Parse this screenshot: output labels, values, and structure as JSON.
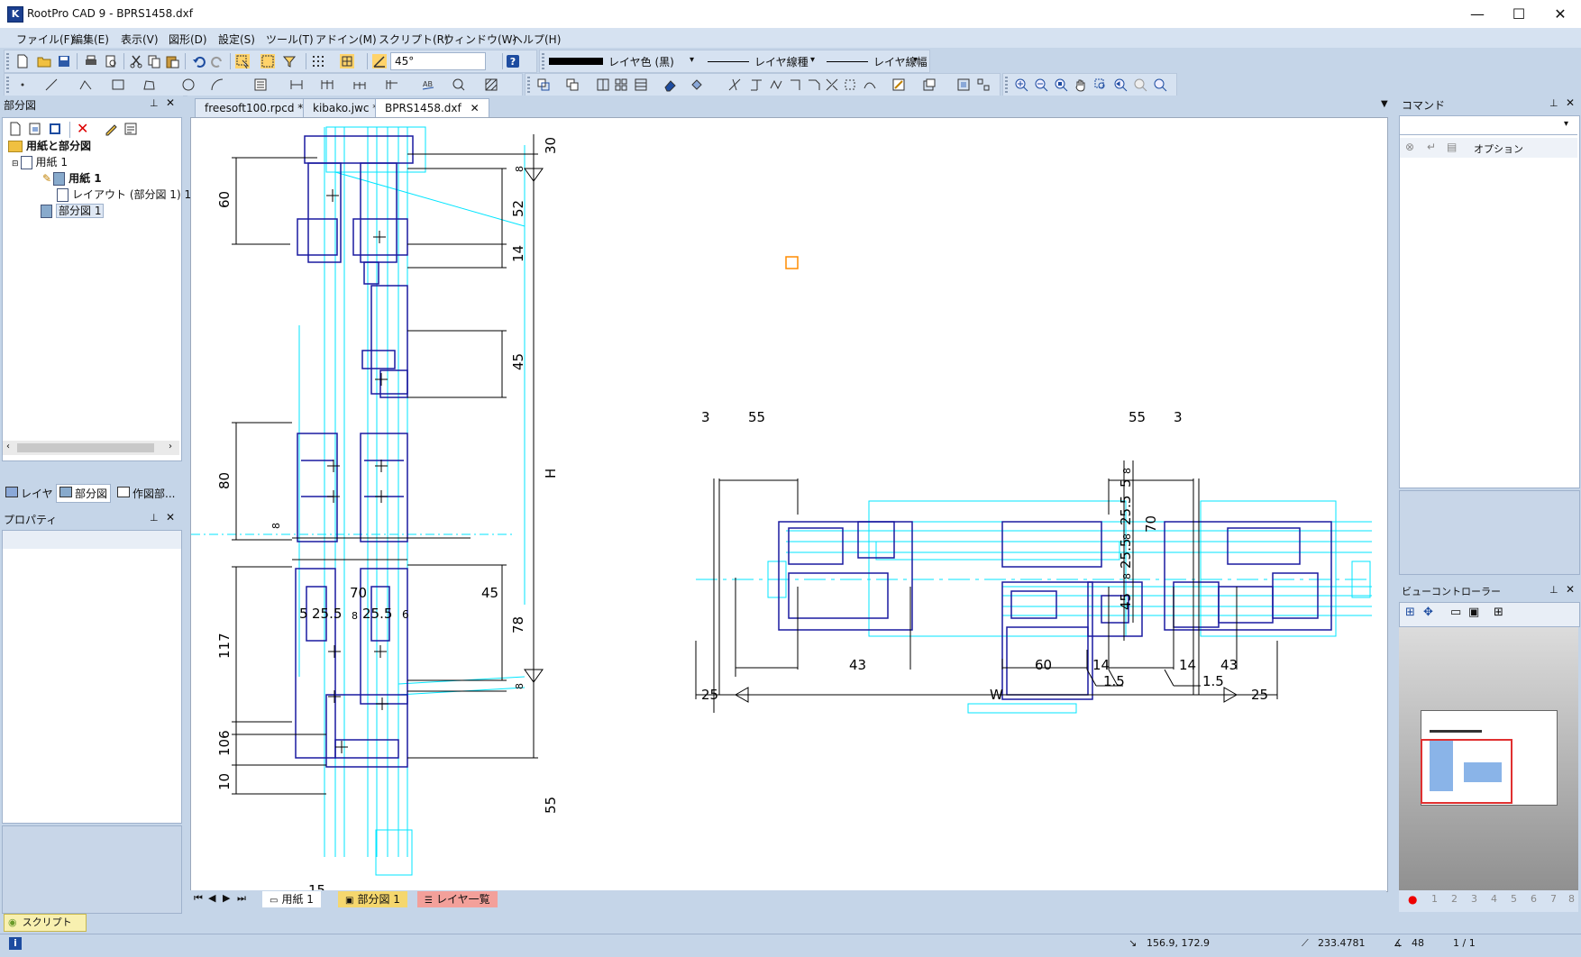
{
  "window": {
    "title": "RootPro CAD 9 - BPRS1458.dxf",
    "app_icon": "K",
    "minimize": "—",
    "maximize": "☐",
    "close": "✕"
  },
  "menu": [
    "ファイル(F)",
    "編集(E)",
    "表示(V)",
    "図形(D)",
    "設定(S)",
    "ツール(T)",
    "アドイン(M)",
    "スクリプト(R)",
    "ウィンドウ(W)",
    "ヘルプ(H)"
  ],
  "toolbar": {
    "angle_value": "45°",
    "layer_color": "レイヤ色 (黒)",
    "layer_linetype": "レイヤ線種",
    "layer_linewidth": "レイヤ線幅"
  },
  "left_panel": {
    "title": "部分図",
    "tree": {
      "root": "用紙と部分図",
      "paper": "用紙 1",
      "paper_child": "用紙 1",
      "layout": "レイアウト (部分図 1) 1/",
      "partial": "部分図 1"
    },
    "bottom_tabs": [
      "レイヤ",
      "部分図",
      "作図部..."
    ],
    "properties_title": "プロパティ"
  },
  "doc_tabs": [
    "freesoft100.rpcd *",
    "kibako.jwc *",
    "BPRS1458.dxf"
  ],
  "sheet_tabs": [
    "用紙 1",
    "部分図 1",
    "レイヤ一覧"
  ],
  "right_panel": {
    "command_title": "コマンド",
    "option_label": "オプション",
    "view_controller_title": "ビューコントローラー",
    "page_numbers": [
      "1",
      "2",
      "3",
      "4",
      "5",
      "6",
      "7",
      "8"
    ]
  },
  "script_button": "スクリプト",
  "status": {
    "coords": "156.9, 172.9",
    "length": "233.4781",
    "angle": "48",
    "page": "1 / 1"
  },
  "drawing": {
    "left_dims": [
      "60",
      "80",
      "117",
      "106",
      "10",
      "15",
      "8"
    ],
    "right_dims": [
      "30",
      "8",
      "52",
      "14",
      "45",
      "H",
      "78",
      "8",
      "55"
    ],
    "mid_dims": [
      "70",
      "45",
      "5",
      "25.5",
      "8",
      "25.5",
      "6"
    ],
    "top_dims": [
      "3",
      "55",
      "55",
      "3"
    ],
    "side_dims": [
      "8",
      "5",
      "25.5",
      "8",
      "25.5",
      "8",
      "45",
      "70"
    ],
    "bottom_dims": [
      "43",
      "60",
      "14",
      "14",
      "43",
      "1.5",
      "1.5",
      "25",
      "W",
      "25"
    ]
  },
  "colors": {
    "profile": "#1a1aa0",
    "glass": "#00e5ff",
    "dim": "#000000",
    "accent": "#ff8c00"
  }
}
